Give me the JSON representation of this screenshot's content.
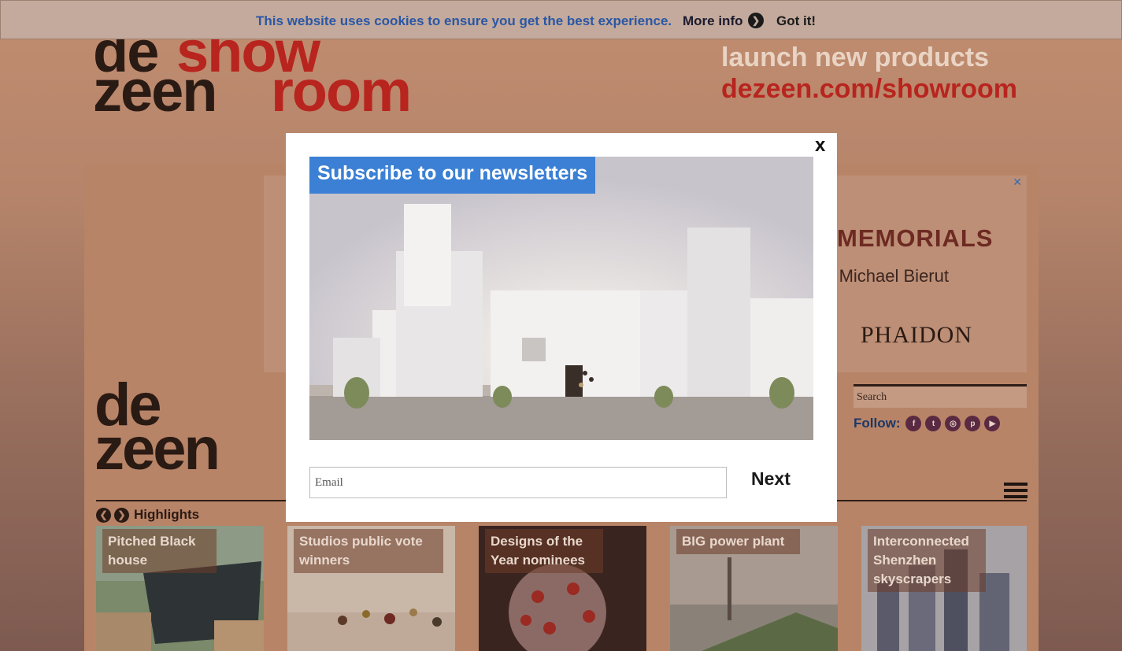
{
  "colors": {
    "cookie_text": "#2a57a5",
    "newsletter_title_bg": "#3b80d4",
    "banner_accent": "#b8241e",
    "overlay_tint": "#b07a60"
  },
  "cookie_bar": {
    "message": "This website uses cookies to ensure you get the best experience.",
    "more_info_label": "More info",
    "more_info_chevron": "❯",
    "got_it_label": "Got it!"
  },
  "showroom_banner": {
    "logo_words": [
      "de",
      "zeen",
      "show",
      "room"
    ],
    "tagline": "launch new products",
    "url": "dezeen.com/showroom"
  },
  "ad": {
    "close_glyph": "✕",
    "headline": "MEMORIALS",
    "subline": "nd Michael Bierut",
    "brand": "PHAIDON"
  },
  "site_logo": {
    "line1": "de",
    "line2": "zeen"
  },
  "search": {
    "placeholder": "Search"
  },
  "follow": {
    "label": "Follow:",
    "icons": [
      "f",
      "t",
      "◎",
      "p",
      "▶"
    ]
  },
  "highlights": {
    "prev_glyph": "❮",
    "next_glyph": "❯",
    "label": "Highlights",
    "tiles": [
      "Pitched Black house",
      "Studios public vote winners",
      "Designs of the Year nominees",
      "BIG power plant",
      "Interconnected Shenzhen skyscrapers"
    ]
  },
  "modal": {
    "close_label": "x",
    "title": "Subscribe to our newsletters",
    "email_placeholder": "Email",
    "next_label": "Next"
  }
}
